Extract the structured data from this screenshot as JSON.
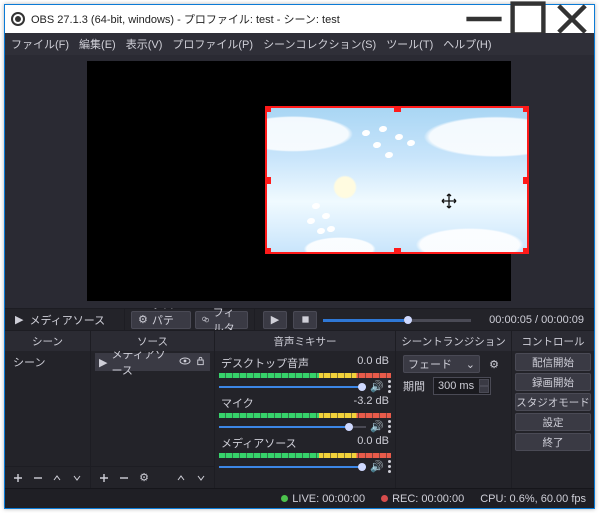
{
  "title": "OBS 27.1.3 (64-bit, windows) - プロファイル: test - シーン: test",
  "menu": {
    "file": "ファイル(F)",
    "edit": "編集(E)",
    "view": "表示(V)",
    "profile": "プロファイル(P)",
    "scenecol": "シーンコレクション(S)",
    "tools": "ツール(T)",
    "help": "ヘルプ(H)"
  },
  "scrub": {
    "caption": "メディアソース",
    "props": "プロパティ",
    "filter": "フィルタ",
    "time_current": "00:00:05",
    "time_total": "00:00:09",
    "progress_pct": 55
  },
  "panels": {
    "scenes": "シーン",
    "sources": "ソース",
    "mixer": "音声ミキサー",
    "transition": "シーントランジション",
    "controls": "コントロール"
  },
  "scenes": {
    "items": [
      "シーン"
    ]
  },
  "sources": {
    "items": [
      "メディアソース"
    ]
  },
  "mixer": {
    "channels": [
      {
        "name": "デスクトップ音声",
        "db": "0.0 dB",
        "vol_pct": 100
      },
      {
        "name": "マイク",
        "db": "-3.2 dB",
        "vol_pct": 88
      },
      {
        "name": "メディアソース",
        "db": "0.0 dB",
        "vol_pct": 100
      }
    ]
  },
  "transition": {
    "type": "フェード",
    "dur_label": "期間",
    "dur_value": "300 ms"
  },
  "controls": {
    "stream": "配信開始",
    "record": "録画開始",
    "studio": "スタジオモード",
    "settings": "設定",
    "exit": "終了"
  },
  "status": {
    "live": "LIVE: 00:00:00",
    "rec": "REC: 00:00:00",
    "cpu": "CPU: 0.6%, 60.00 fps"
  },
  "icons": {
    "play": "▶",
    "gear": "⚙",
    "chev": "⌄",
    "speaker": "🔊",
    "eye": "👁"
  }
}
